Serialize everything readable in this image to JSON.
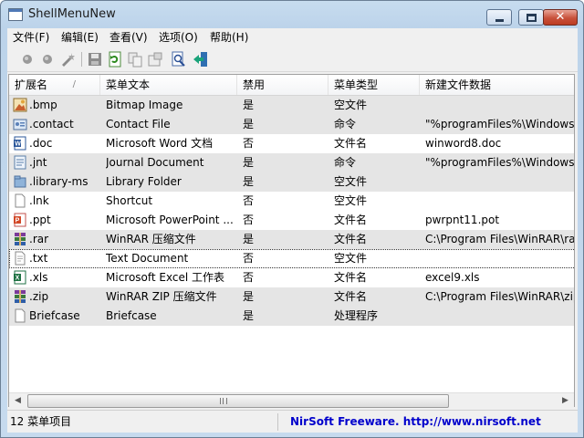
{
  "window": {
    "title": "ShellMenuNew"
  },
  "caption_buttons": {
    "close": "✕"
  },
  "menu": [
    {
      "label": "文件(F)"
    },
    {
      "label": "编辑(E)"
    },
    {
      "label": "查看(V)"
    },
    {
      "label": "选项(O)"
    },
    {
      "label": "帮助(H)"
    }
  ],
  "toolbar": {
    "buttons": [
      "enable-icon",
      "disable-icon",
      "wizard-icon",
      "save-icon",
      "refresh-icon",
      "copy-icon",
      "properties-icon",
      "find-icon",
      "exit-icon"
    ]
  },
  "columns": [
    {
      "label": "扩展名",
      "sorted": true
    },
    {
      "label": "菜单文本"
    },
    {
      "label": "禁用"
    },
    {
      "label": "菜单类型"
    },
    {
      "label": "新建文件数据"
    }
  ],
  "rows": [
    {
      "ext": ".bmp",
      "text": "Bitmap Image",
      "disabled": "是",
      "type": "空文件",
      "data": "",
      "icon": "bmp-icon"
    },
    {
      "ext": ".contact",
      "text": "Contact File",
      "disabled": "是",
      "type": "命令",
      "data": "\"%programFiles%\\Windows C",
      "icon": "contact-icon"
    },
    {
      "ext": ".doc",
      "text": "Microsoft Word 文档",
      "disabled": "否",
      "type": "文件名",
      "data": "winword8.doc",
      "icon": "word-icon"
    },
    {
      "ext": ".jnt",
      "text": "Journal Document",
      "disabled": "是",
      "type": "命令",
      "data": "\"%programFiles%\\Windows J",
      "icon": "journal-icon"
    },
    {
      "ext": ".library-ms",
      "text": "Library Folder",
      "disabled": "是",
      "type": "空文件",
      "data": "",
      "icon": "library-icon"
    },
    {
      "ext": ".lnk",
      "text": "Shortcut",
      "disabled": "否",
      "type": "空文件",
      "data": "",
      "icon": "shortcut-icon"
    },
    {
      "ext": ".ppt",
      "text": "Microsoft PowerPoint ...",
      "disabled": "否",
      "type": "文件名",
      "data": "pwrpnt11.pot",
      "icon": "powerpoint-icon"
    },
    {
      "ext": ".rar",
      "text": "WinRAR 压缩文件",
      "disabled": "是",
      "type": "文件名",
      "data": "C:\\Program Files\\WinRAR\\rar",
      "icon": "winrar-icon"
    },
    {
      "ext": ".txt",
      "text": "Text Document",
      "disabled": "否",
      "type": "空文件",
      "data": "",
      "icon": "text-file-icon"
    },
    {
      "ext": ".xls",
      "text": "Microsoft Excel 工作表",
      "disabled": "否",
      "type": "文件名",
      "data": "excel9.xls",
      "icon": "excel-icon"
    },
    {
      "ext": ".zip",
      "text": "WinRAR ZIP 压缩文件",
      "disabled": "是",
      "type": "文件名",
      "data": "C:\\Program Files\\WinRAR\\zip",
      "icon": "winrar-zip-icon"
    },
    {
      "ext": "Briefcase",
      "text": "Briefcase",
      "disabled": "是",
      "type": "处理程序",
      "data": "",
      "icon": "briefcase-icon"
    }
  ],
  "status": {
    "count": "12 菜单项目",
    "link": "NirSoft Freeware.  http://www.nirsoft.net"
  },
  "colors": {
    "shaded_row": "#e5e5e5",
    "link": "#0000cc",
    "close_button": "#c8513b"
  }
}
